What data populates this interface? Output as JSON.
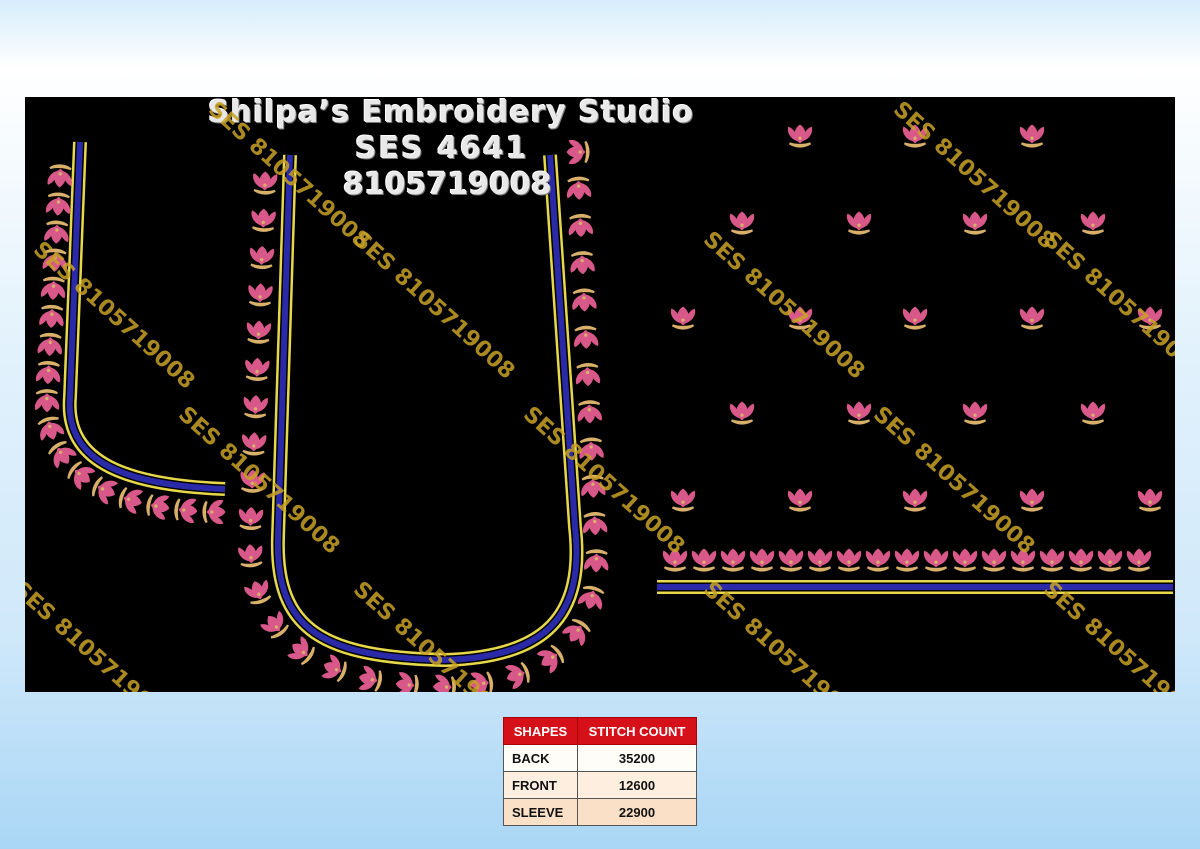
{
  "header": {
    "studio_name": "Shilpa’s Embroidery Studio",
    "design_code": "SES 4641",
    "phone": "8105719008"
  },
  "watermark_text": "SES 8105719008",
  "colors": {
    "background_panel": "#000000",
    "border_gold": "#e6d84a",
    "border_blue": "#2a2aa8",
    "flower_pink": "#d9588a",
    "flower_gold": "#d8b06a",
    "watermark": "#c9a227",
    "table_header": "#d61018"
  },
  "design_parts": [
    "sleeve-neck-curve",
    "back-neck",
    "front-butta-and-border"
  ],
  "stitch_table": {
    "headers": [
      "SHAPES",
      "STITCH COUNT"
    ],
    "rows": [
      {
        "shape": "BACK",
        "count": "35200"
      },
      {
        "shape": "FRONT",
        "count": "12600"
      },
      {
        "shape": "SLEEVE",
        "count": "22900"
      }
    ]
  }
}
